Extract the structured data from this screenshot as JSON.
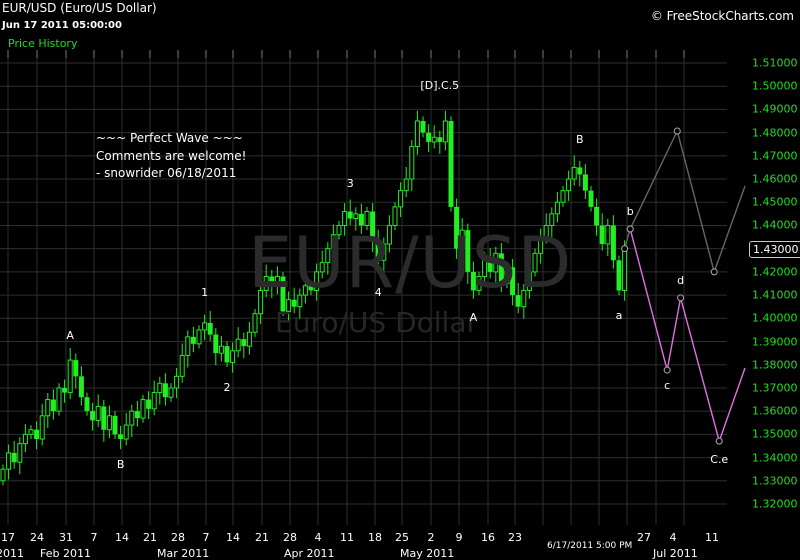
{
  "header": {
    "title": "EUR/USD (Euro/US Dollar)",
    "datetime": "Jun 17 2011 05:00:00",
    "panel_label": "Price History",
    "copyright": "© FreeStockCharts.com"
  },
  "watermark": {
    "symbol": "EUR/USD",
    "name": "Euro/US Dollar"
  },
  "comments": [
    "~~~ Perfect Wave ~~~",
    "Comments are welcome!",
    "- snowrider  06/18/2011"
  ],
  "colors": {
    "candle": "#22ee22",
    "grid": "#2e2e2e",
    "projection_pink": "#e070e0",
    "projection_grey": "#666666",
    "axis_text": "#22dd22"
  },
  "chart_data": {
    "type": "candlestick",
    "title": "EUR/USD (Euro/US Dollar)",
    "ylim": [
      1.315,
      1.515
    ],
    "yticks": [
      "1.51000",
      "1.50000",
      "1.49000",
      "1.48000",
      "1.47000",
      "1.46000",
      "1.45000",
      "1.44000",
      "1.43000",
      "1.42000",
      "1.41000",
      "1.40000",
      "1.39000",
      "1.38000",
      "1.37000",
      "1.36000",
      "1.35000",
      "1.34000",
      "1.33000",
      "1.32000"
    ],
    "last_price": "1.43000",
    "crosshair_label": "6/17/2011 5:00 PM",
    "xtick_labels": [
      "17",
      "24",
      "31",
      "7",
      "14",
      "21",
      "28",
      "7",
      "14",
      "21",
      "28",
      "4",
      "11",
      "18",
      "25",
      "2",
      "9",
      "16",
      "23",
      "27",
      "4",
      "11"
    ],
    "month_labels": [
      "2011",
      "Feb 2011",
      "Mar 2011",
      "Apr 2011",
      "May 2011",
      "Jul 2011"
    ],
    "start_open": 1.33,
    "avg_wick": 0.004,
    "closes": [
      1.335,
      1.342,
      1.338,
      1.346,
      1.35,
      1.352,
      1.348,
      1.358,
      1.365,
      1.36,
      1.37,
      1.368,
      1.382,
      1.375,
      1.366,
      1.36,
      1.356,
      1.362,
      1.352,
      1.358,
      1.35,
      1.348,
      1.354,
      1.36,
      1.357,
      1.365,
      1.361,
      1.368,
      1.372,
      1.366,
      1.37,
      1.375,
      1.384,
      1.392,
      1.389,
      1.395,
      1.398,
      1.393,
      1.385,
      1.388,
      1.381,
      1.386,
      1.391,
      1.388,
      1.394,
      1.402,
      1.412,
      1.418,
      1.414,
      1.418,
      1.403,
      1.408,
      1.405,
      1.41,
      1.414,
      1.412,
      1.42,
      1.424,
      1.43,
      1.436,
      1.44,
      1.446,
      1.443,
      1.445,
      1.44,
      1.446,
      1.433,
      1.425,
      1.432,
      1.44,
      1.448,
      1.455,
      1.46,
      1.474,
      1.485,
      1.48,
      1.476,
      1.478,
      1.476,
      1.485,
      1.448,
      1.43,
      1.438,
      1.42,
      1.412,
      1.418,
      1.425,
      1.42,
      1.428,
      1.415,
      1.422,
      1.41,
      1.405,
      1.412,
      1.42,
      1.428,
      1.435,
      1.44,
      1.445,
      1.45,
      1.455,
      1.46,
      1.465,
      1.462,
      1.455,
      1.448,
      1.44,
      1.432,
      1.44,
      1.425,
      1.412,
      1.43
    ],
    "projection_pink": [
      [
        112,
        1.4385
      ],
      [
        118.6,
        1.3777
      ],
      [
        121,
        1.4088
      ],
      [
        127.9,
        1.3471
      ],
      [
        132.5,
        1.3786
      ]
    ],
    "projection_grey": [
      [
        111,
        1.43
      ],
      [
        112,
        1.4385
      ],
      [
        120.4,
        1.4807
      ],
      [
        127,
        1.42
      ],
      [
        132.5,
        1.457
      ]
    ],
    "wave_labels": [
      {
        "text": "A",
        "bar": 12,
        "price": 1.3925
      },
      {
        "text": "B",
        "bar": 21,
        "price": 1.337
      },
      {
        "text": "1",
        "bar": 36,
        "price": 1.411
      },
      {
        "text": "2",
        "bar": 40,
        "price": 1.37
      },
      {
        "text": "3",
        "bar": 62,
        "price": 1.458
      },
      {
        "text": "4",
        "bar": 67,
        "price": 1.411
      },
      {
        "text": "[D].C.5",
        "bar": 78,
        "price": 1.5
      },
      {
        "text": "A",
        "bar": 84,
        "price": 1.4
      },
      {
        "text": "B",
        "bar": 103,
        "price": 1.477
      },
      {
        "text": "a",
        "bar": 110,
        "price": 1.401
      },
      {
        "text": "b",
        "bar": 112,
        "price": 1.446
      },
      {
        "text": "c",
        "bar": 118.6,
        "price": 1.371
      },
      {
        "text": "d",
        "bar": 121,
        "price": 1.416
      },
      {
        "text": "C.e",
        "bar": 127.9,
        "price": 1.339
      }
    ]
  }
}
